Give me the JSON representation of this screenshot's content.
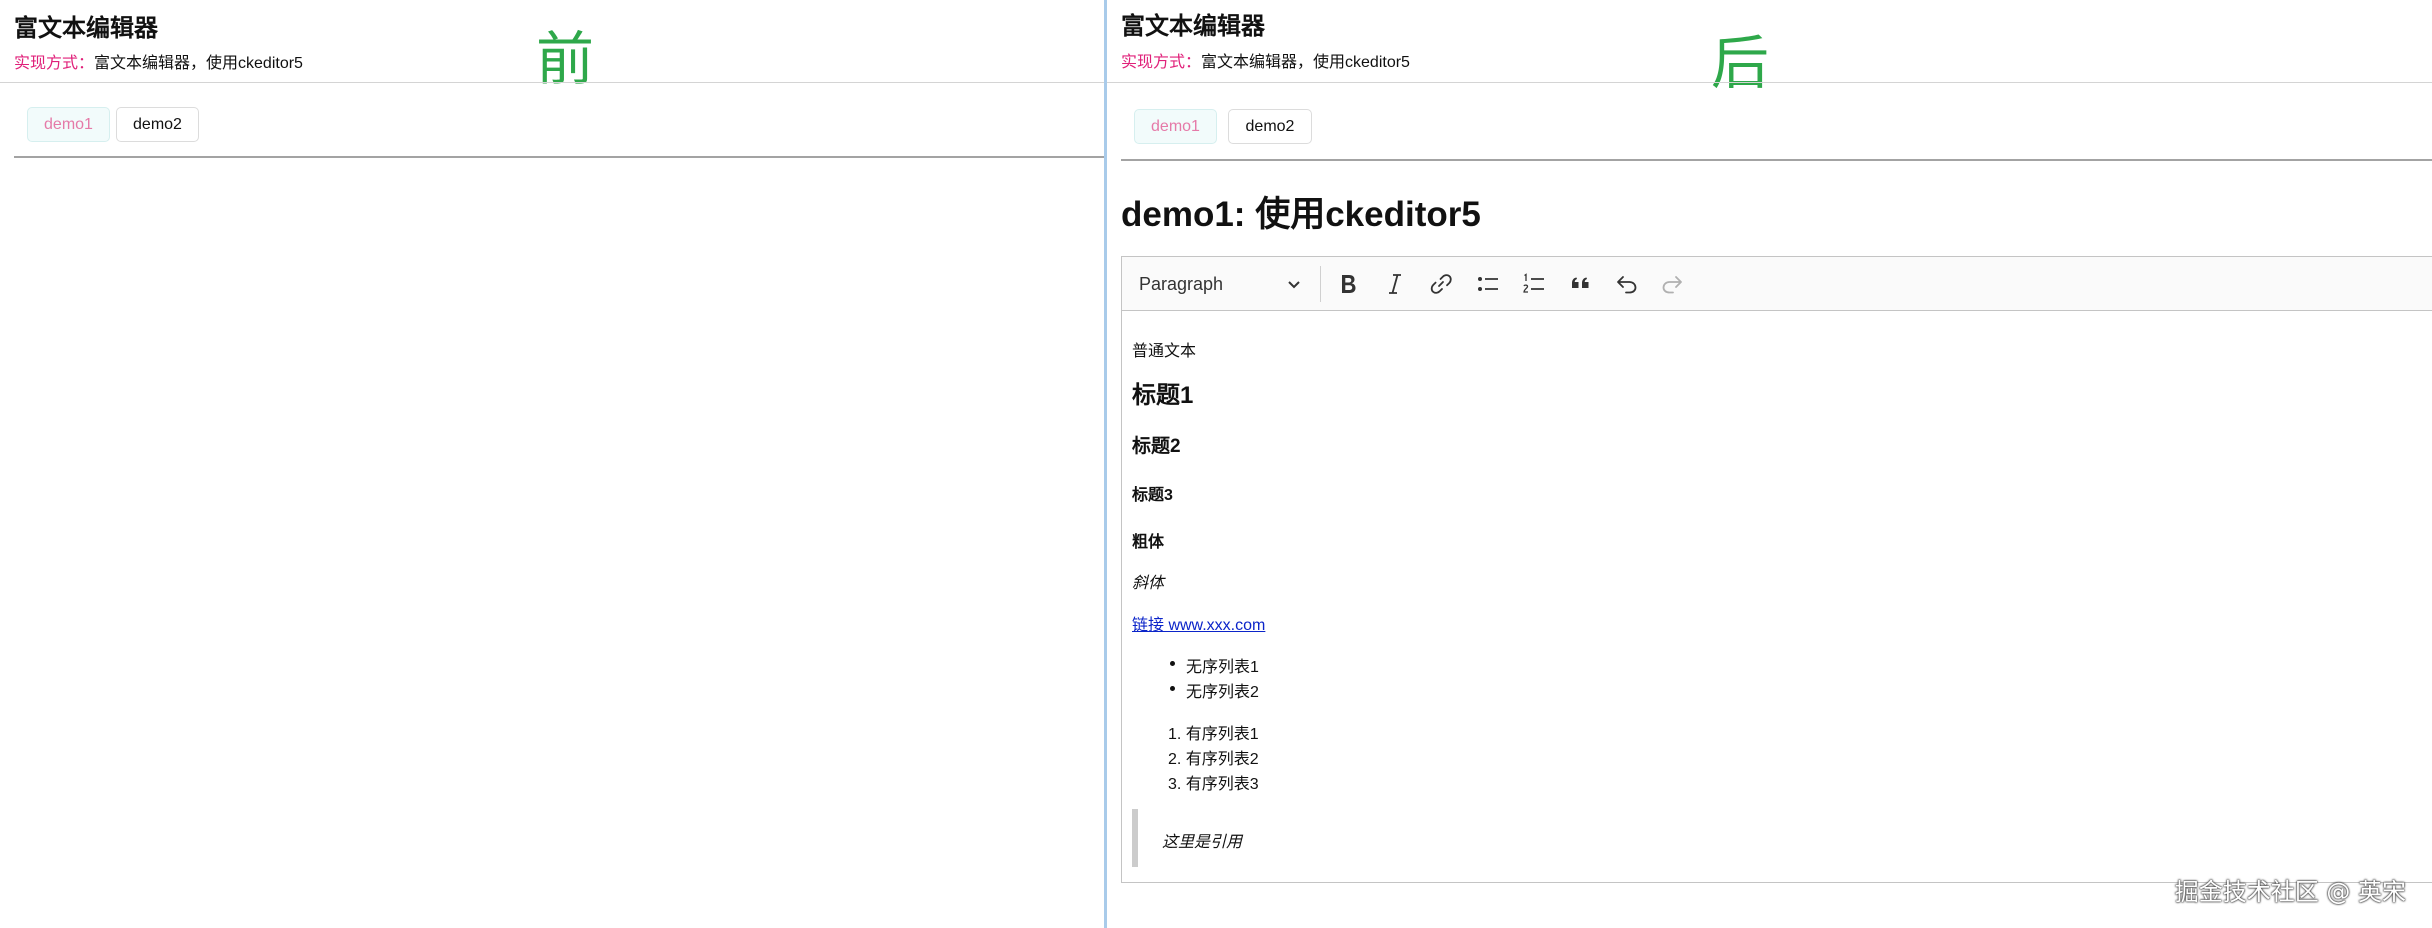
{
  "left": {
    "title": "富文本编辑器",
    "impl_label": "实现方式：",
    "impl_value": "富文本编辑器，使用ckeditor5",
    "marker": "前",
    "tabs": [
      {
        "label": "demo1",
        "active": true
      },
      {
        "label": "demo2",
        "active": false
      }
    ]
  },
  "right": {
    "title": "富文本编辑器",
    "impl_label": "实现方式：",
    "impl_value": "富文本编辑器，使用ckeditor5",
    "marker": "后",
    "tabs": [
      {
        "label": "demo1",
        "active": true
      },
      {
        "label": "demo2",
        "active": false
      }
    ],
    "demo_heading": "demo1: 使用ckeditor5",
    "editor": {
      "toolbar": {
        "heading_select": "Paragraph",
        "buttons": [
          "bold-icon",
          "italic-icon",
          "link-icon",
          "bulleted-list-icon",
          "numbered-list-icon",
          "blockquote-icon",
          "undo-icon",
          "redo-icon"
        ]
      },
      "content": {
        "paragraph": "普通文本",
        "heading1": "标题1",
        "heading2": "标题2",
        "heading3": "标题3",
        "bold": "粗体",
        "italic": "斜体",
        "link": "链接 www.xxx.com",
        "unordered": [
          "无序列表1",
          "无序列表2"
        ],
        "ordered": [
          "1. 有序列表1",
          "2. 有序列表2",
          "3. 有序列表3"
        ],
        "quote": "这里是引用"
      }
    }
  },
  "watermark": "掘金技术社区 @ 英宋",
  "colors": {
    "marker": "#2ea84a",
    "impl_label": "#e0217a",
    "active_tab_text": "#e57aa8",
    "active_tab_bg": "#f2fbfb",
    "link": "#0b24c9"
  }
}
